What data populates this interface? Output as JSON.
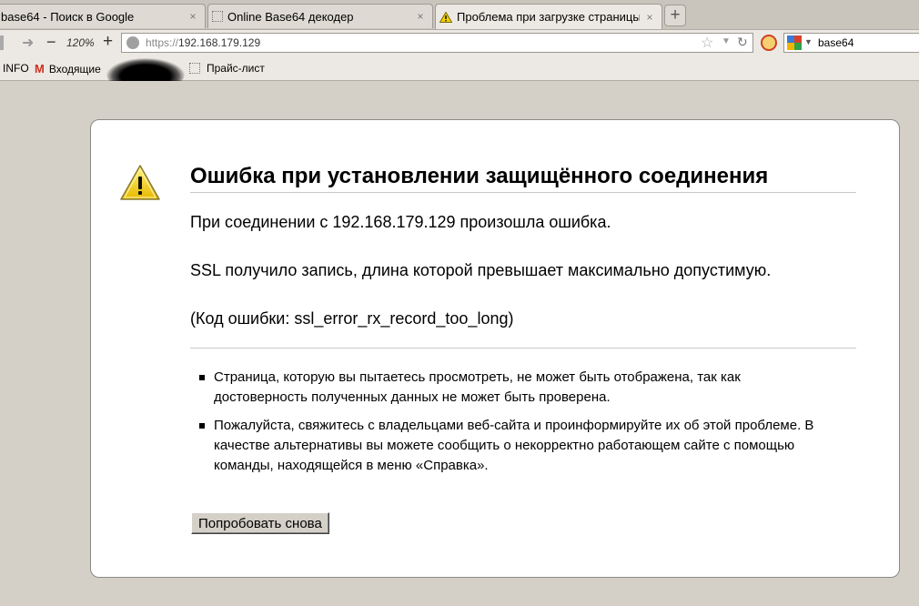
{
  "tabs": [
    {
      "title": "base64 - Поиск в Google",
      "close": "×"
    },
    {
      "title": "Online Base64 декодер",
      "close": "×"
    },
    {
      "title": "Проблема при загрузке страницы",
      "close": "×"
    }
  ],
  "new_tab": "+",
  "nav": {
    "forward": "➜",
    "zoom_minus": "−",
    "zoom_level": "120%",
    "zoom_plus": "+",
    "url_scheme": "https://",
    "url_host": "192.168.179.129",
    "star": "☆",
    "dropmarker": "▼",
    "reload": "↻",
    "search_value": "base64",
    "search_dropmarker": "▼"
  },
  "bookmarks": {
    "info": "INFO",
    "gmail_icon": "M",
    "inbox": "Входящие",
    "pricelist": "Прайс-лист"
  },
  "error": {
    "title": "Ошибка при установлении защищённого соединения",
    "p1": "При соединении с 192.168.179.129 произошла ошибка.",
    "p2": "SSL получило запись, длина которой превышает максимально допустимую.",
    "p3": "(Код ошибки: ssl_error_rx_record_too_long)",
    "bullets": [
      "Страница, которую вы пытаетесь просмотреть, не может быть отображена, так как достоверность полученных данных не может быть проверена.",
      "Пожалуйста, свяжитесь с владельцами веб-сайта и проинформируйте их об этой проблеме. В качестве альтернативы вы можете сообщить о некорректно работающем сайте с помощью команды, находящейся в меню «Справка»."
    ],
    "retry": "Попробовать снова"
  },
  "icons": {
    "warning": "warning-triangle-icon",
    "site": "globe-icon",
    "addon": "blocked-addon-icon",
    "engine": "google-icon"
  },
  "colors": {
    "chrome_bg": "#ece9e4",
    "page_bg": "#d4d0c8",
    "warning_yellow": "#f4d000",
    "gmail_red": "#d03020"
  }
}
